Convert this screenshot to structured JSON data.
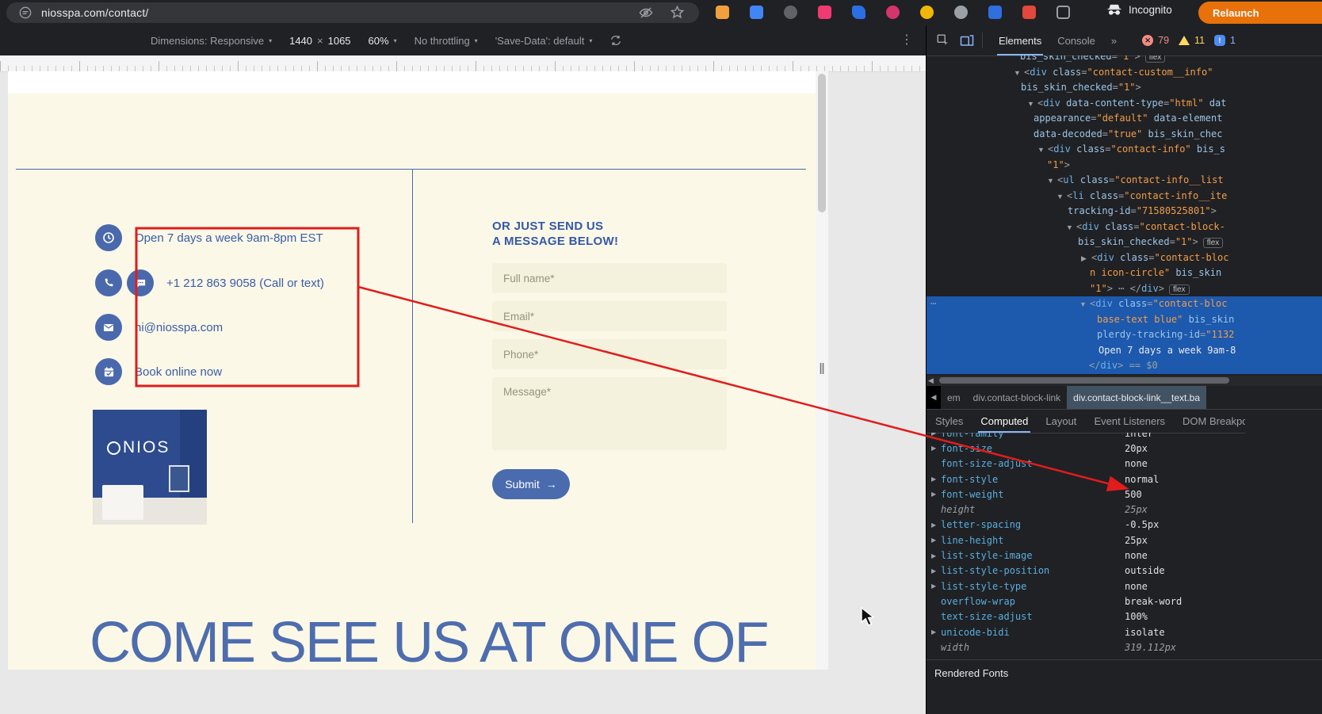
{
  "browser": {
    "url": "niosspa.com/contact/",
    "incognito_label": "Incognito",
    "relaunch_label": "Relaunch",
    "extensions": [
      {
        "name": "extension-1",
        "color": "#f0a03c",
        "shape": "square"
      },
      {
        "name": "extension-2",
        "color": "#4285f4",
        "shape": "square"
      },
      {
        "name": "extension-3",
        "color": "#5f6368",
        "shape": "circle"
      },
      {
        "name": "extension-4",
        "color": "#ef3a72",
        "shape": "square"
      },
      {
        "name": "extension-5",
        "color": "#2b6fe4",
        "shape": "pen"
      },
      {
        "name": "extension-6",
        "color": "#d4356b",
        "shape": "circle"
      },
      {
        "name": "extension-7",
        "color": "#f2b705",
        "shape": "circle"
      },
      {
        "name": "extension-8",
        "color": "#9aa0a6",
        "shape": "circle"
      },
      {
        "name": "extension-9",
        "color": "#2f6fe0",
        "shape": "square"
      },
      {
        "name": "extension-10",
        "color": "#e2483d",
        "shape": "square"
      },
      {
        "name": "extensions-menu",
        "color": "#9aa0a6",
        "shape": "puzzle"
      }
    ]
  },
  "device_toolbar": {
    "dimensions_label": "Dimensions: Responsive",
    "width_value": "1440",
    "multiply": "×",
    "height_value": "1065",
    "zoom_value": "60%",
    "throttling_value": "No throttling",
    "save_data_value": "'Save-Data': default"
  },
  "page": {
    "contact_items": [
      {
        "icons": [
          "clock"
        ],
        "text": "Open 7 days a week 9am-8pm EST"
      },
      {
        "icons": [
          "phone",
          "chat"
        ],
        "text": "+1 212 863 9058 (Call or text)"
      },
      {
        "icons": [
          "mail"
        ],
        "text": "hi@niosspa.com"
      },
      {
        "icons": [
          "calendar"
        ],
        "text": "Book online now"
      }
    ],
    "store_logo": "NIOS",
    "form": {
      "heading_line1": "OR JUST SEND US",
      "heading_line2": "A MESSAGE BELOW!",
      "fields": [
        "Full name*",
        "Email*",
        "Phone*",
        "Message*"
      ],
      "submit_label": "Submit",
      "submit_arrow": "→"
    },
    "big_heading": "COME SEE US AT ONE OF"
  },
  "devtools": {
    "tabs": [
      {
        "label": "Elements",
        "selected": true
      },
      {
        "label": "Console",
        "selected": false
      },
      {
        "label": "»",
        "selected": false
      }
    ],
    "badges": {
      "errors": "79",
      "warnings": "11",
      "issues": "1"
    },
    "tree": [
      {
        "i": 118,
        "seg": [
          [
            "a",
            "bis_skin_checked"
          ],
          [
            "p",
            "="
          ],
          [
            "v",
            "\"1\""
          ],
          [
            "p",
            ">"
          ]
        ],
        "badge": "flex"
      },
      {
        "i": 110,
        "ar": "d",
        "seg": [
          [
            "p",
            "<"
          ],
          [
            "t",
            "div"
          ],
          [
            "x",
            " "
          ],
          [
            "a",
            "class"
          ],
          [
            "p",
            "="
          ],
          [
            "v",
            "\"contact-custom__info\""
          ]
        ]
      },
      {
        "i": 119,
        "seg": [
          [
            "a",
            "bis_skin_checked"
          ],
          [
            "p",
            "="
          ],
          [
            "v",
            "\"1\""
          ],
          [
            "p",
            ">"
          ]
        ]
      },
      {
        "i": 127,
        "ar": "d",
        "seg": [
          [
            "p",
            "<"
          ],
          [
            "t",
            "div"
          ],
          [
            "x",
            " "
          ],
          [
            "a",
            "data-content-type"
          ],
          [
            "p",
            "="
          ],
          [
            "v",
            "\"html\""
          ],
          [
            "x",
            " "
          ],
          [
            "a",
            "dat"
          ]
        ]
      },
      {
        "i": 135,
        "seg": [
          [
            "a",
            "appearance"
          ],
          [
            "p",
            "="
          ],
          [
            "v",
            "\"default\""
          ],
          [
            "x",
            " "
          ],
          [
            "a",
            "data-element"
          ]
        ]
      },
      {
        "i": 135,
        "seg": [
          [
            "a",
            "data-decoded"
          ],
          [
            "p",
            "="
          ],
          [
            "v",
            "\"true\""
          ],
          [
            "x",
            " "
          ],
          [
            "a",
            "bis_skin_chec"
          ]
        ]
      },
      {
        "i": 140,
        "ar": "d",
        "seg": [
          [
            "p",
            "<"
          ],
          [
            "t",
            "div"
          ],
          [
            "x",
            " "
          ],
          [
            "a",
            "class"
          ],
          [
            "p",
            "="
          ],
          [
            "v",
            "\"contact-info\""
          ],
          [
            "x",
            " "
          ],
          [
            "a",
            "bis_s"
          ]
        ]
      },
      {
        "i": 152,
        "seg": [
          [
            "v",
            "\"1\""
          ],
          [
            "p",
            ">"
          ]
        ]
      },
      {
        "i": 152,
        "ar": "d",
        "seg": [
          [
            "p",
            "<"
          ],
          [
            "t",
            "ul"
          ],
          [
            "x",
            " "
          ],
          [
            "a",
            "class"
          ],
          [
            "p",
            "="
          ],
          [
            "v",
            "\"contact-info__list"
          ]
        ]
      },
      {
        "i": 164,
        "ar": "d",
        "seg": [
          [
            "p",
            "<"
          ],
          [
            "t",
            "li"
          ],
          [
            "x",
            " "
          ],
          [
            "a",
            "class"
          ],
          [
            "p",
            "="
          ],
          [
            "v",
            "\"contact-info__ite"
          ]
        ]
      },
      {
        "i": 178,
        "seg": [
          [
            "a",
            "tracking-id"
          ],
          [
            "p",
            "="
          ],
          [
            "v",
            "\"71580525801\""
          ],
          [
            "p",
            ">"
          ]
        ]
      },
      {
        "i": 176,
        "ar": "d",
        "seg": [
          [
            "p",
            "<"
          ],
          [
            "t",
            "div"
          ],
          [
            "x",
            " "
          ],
          [
            "a",
            "class"
          ],
          [
            "p",
            "="
          ],
          [
            "v",
            "\"contact-block-"
          ]
        ]
      },
      {
        "i": 191,
        "seg": [
          [
            "a",
            "bis_skin_checked"
          ],
          [
            "p",
            "="
          ],
          [
            "v",
            "\"1\""
          ],
          [
            "p",
            ">"
          ]
        ],
        "badge": "flex"
      },
      {
        "i": 195,
        "ar": "r",
        "seg": [
          [
            "p",
            "<"
          ],
          [
            "t",
            "div"
          ],
          [
            "x",
            " "
          ],
          [
            "a",
            "class"
          ],
          [
            "p",
            "="
          ],
          [
            "v",
            "\"contact-bloc"
          ]
        ]
      },
      {
        "i": 206,
        "seg": [
          [
            "v",
            "n icon-circle\""
          ],
          [
            "x",
            " "
          ],
          [
            "a",
            "bis_skin"
          ]
        ]
      },
      {
        "i": 206,
        "seg": [
          [
            "v",
            "\"1\""
          ],
          [
            "p",
            ">"
          ],
          [
            "x",
            " "
          ],
          [
            "d",
            "⋯"
          ],
          [
            "x",
            " "
          ],
          [
            "p",
            "</"
          ],
          [
            "t",
            "div"
          ],
          [
            "p",
            ">"
          ]
        ],
        "badge": "flex"
      },
      {
        "i": 193,
        "ar": "d",
        "sel": true,
        "dots": true,
        "seg": [
          [
            "p",
            "<"
          ],
          [
            "t",
            "div"
          ],
          [
            "x",
            " "
          ],
          [
            "a",
            "class"
          ],
          [
            "p",
            "="
          ],
          [
            "v",
            "\"contact-bloc"
          ]
        ]
      },
      {
        "i": 215,
        "sel": true,
        "seg": [
          [
            "v",
            "base-text blue\""
          ],
          [
            "x",
            " "
          ],
          [
            "a",
            "bis_skin"
          ]
        ]
      },
      {
        "i": 215,
        "sel": true,
        "seg": [
          [
            "a",
            "plerdy-tracking-id"
          ],
          [
            "p",
            "="
          ],
          [
            "v",
            "\"1132"
          ]
        ]
      },
      {
        "i": 217,
        "sel": true,
        "seg": [
          [
            "x",
            "Open 7 days a week 9am-8"
          ]
        ]
      },
      {
        "i": 205,
        "sel": true,
        "seg": [
          [
            "p",
            "</"
          ],
          [
            "t",
            "div"
          ],
          [
            "p",
            ">"
          ],
          [
            "x",
            " "
          ],
          [
            "d",
            "== $0"
          ]
        ]
      }
    ],
    "breadcrumbs": [
      "em",
      "div.contact-block-link",
      "div.contact-block-link__text.ba"
    ],
    "sidebar_tabs": [
      {
        "label": "Styles",
        "selected": false
      },
      {
        "label": "Computed",
        "selected": true
      },
      {
        "label": "Layout",
        "selected": false
      },
      {
        "label": "Event Listeners",
        "selected": false
      },
      {
        "label": "DOM Breakpoints",
        "selected": false
      }
    ],
    "computed": [
      {
        "n": "font-family",
        "v": "inter",
        "e": true,
        "cut": true
      },
      {
        "n": "font-size",
        "v": "20px",
        "e": true
      },
      {
        "n": "font-size-adjust",
        "v": "none"
      },
      {
        "n": "font-style",
        "v": "normal",
        "e": true
      },
      {
        "n": "font-weight",
        "v": "500",
        "e": true
      },
      {
        "n": "height",
        "v": "25px",
        "it": true
      },
      {
        "n": "letter-spacing",
        "v": "-0.5px",
        "e": true
      },
      {
        "n": "line-height",
        "v": "25px",
        "e": true
      },
      {
        "n": "list-style-image",
        "v": "none",
        "e": true
      },
      {
        "n": "list-style-position",
        "v": "outside",
        "e": true
      },
      {
        "n": "list-style-type",
        "v": "none",
        "e": true
      },
      {
        "n": "overflow-wrap",
        "v": "break-word"
      },
      {
        "n": "text-size-adjust",
        "v": "100%"
      },
      {
        "n": "unicode-bidi",
        "v": "isolate",
        "e": true
      },
      {
        "n": "width",
        "v": "319.112px",
        "it": true
      }
    ],
    "rendered_fonts_label": "Rendered Fonts"
  }
}
